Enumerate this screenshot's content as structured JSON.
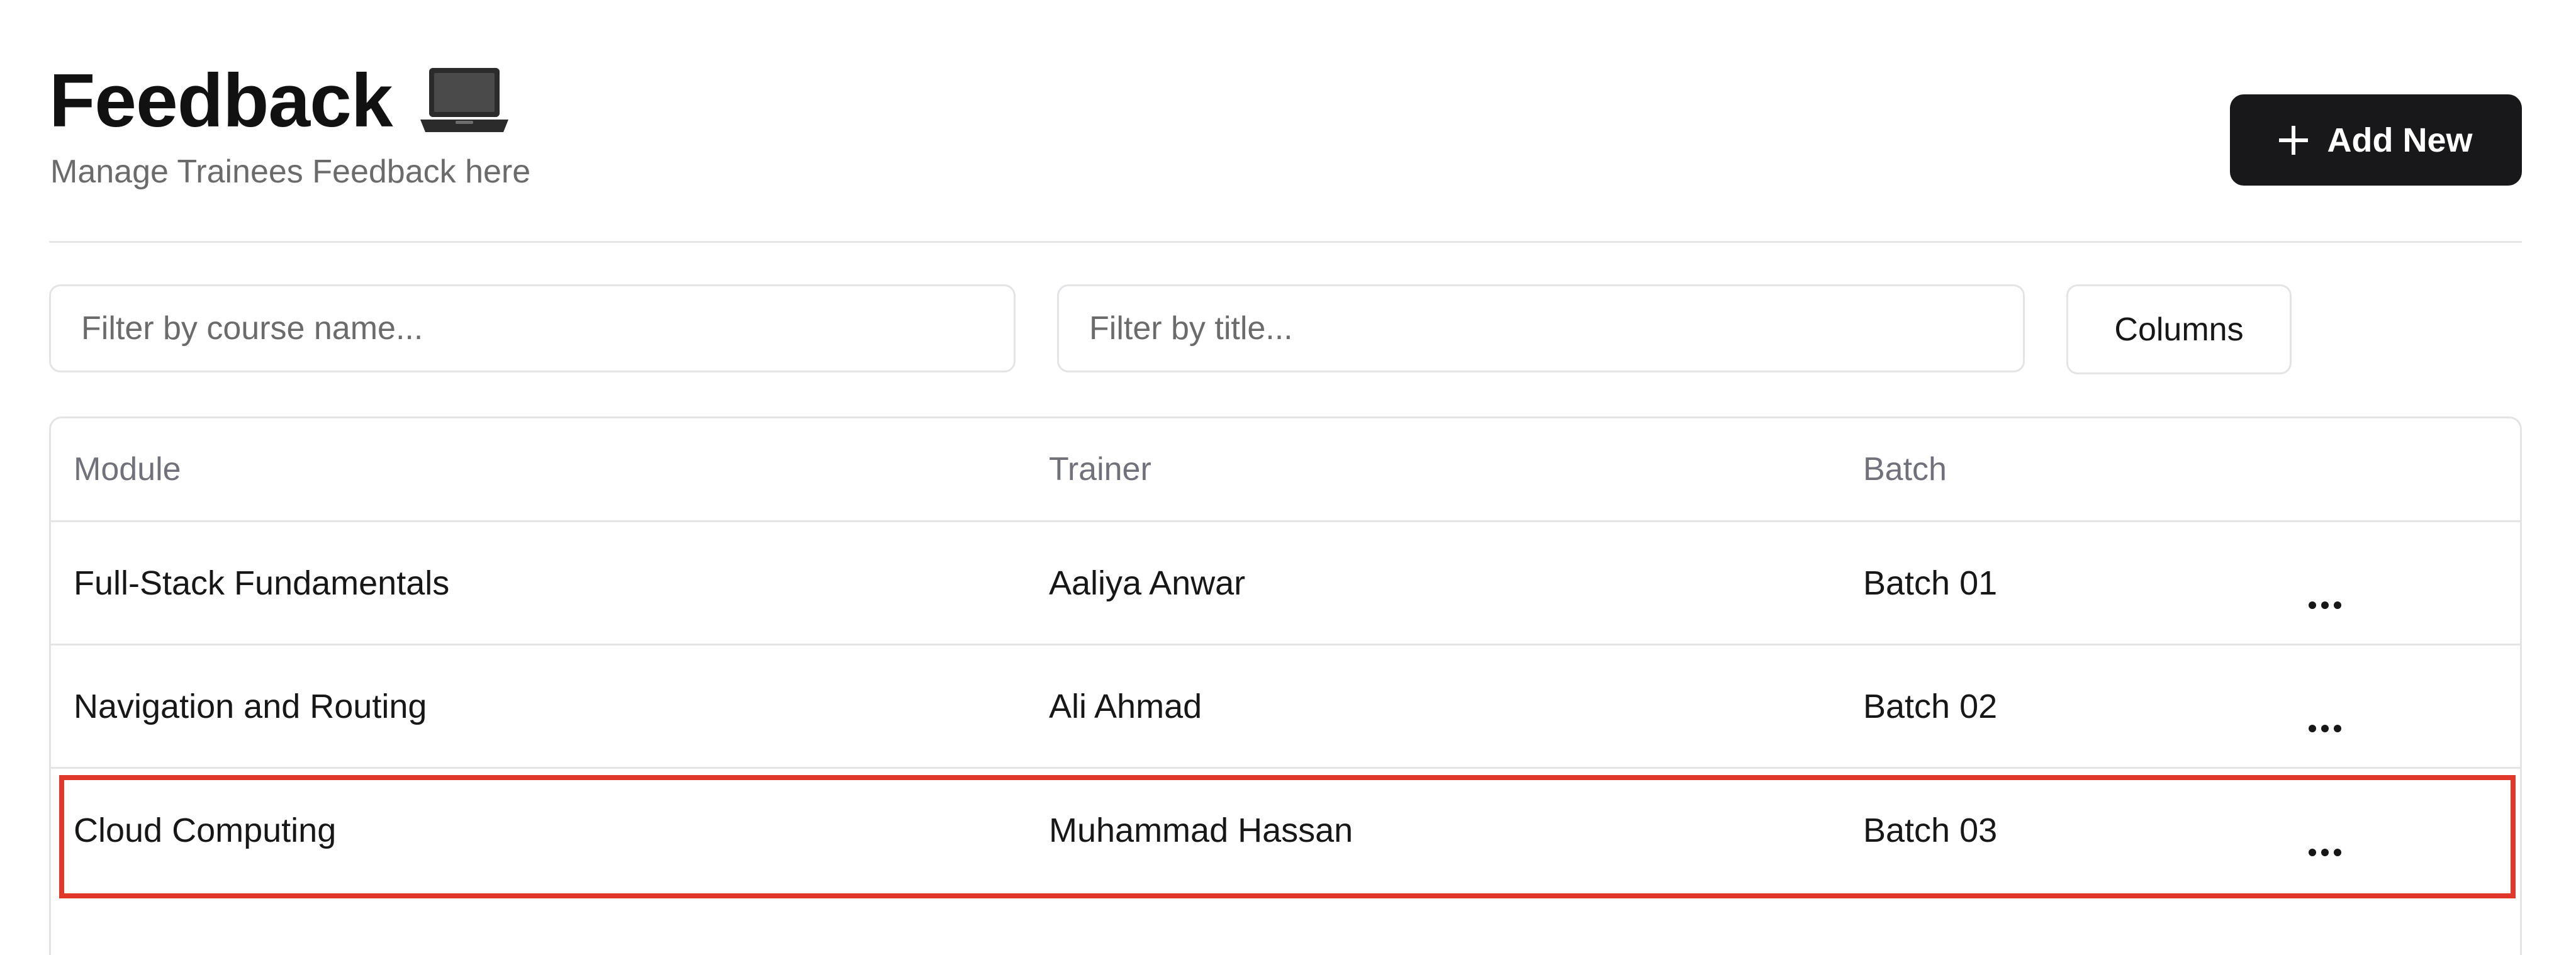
{
  "header": {
    "title": "Feedback",
    "subtitle": "Manage Trainees Feedback here",
    "title_icon": "laptop-icon",
    "add_button": {
      "label": "Add New",
      "icon": "plus-icon"
    }
  },
  "filters": {
    "course_placeholder": "Filter by course name...",
    "title_placeholder": "Filter by title...",
    "columns_label": "Columns"
  },
  "table": {
    "headers": {
      "module": "Module",
      "trainer": "Trainer",
      "batch": "Batch"
    },
    "rows": [
      {
        "module": "Full-Stack Fundamentals",
        "trainer": "Aaliya Anwar",
        "batch": "Batch 01",
        "actions_icon": "more-horizontal-icon"
      },
      {
        "module": "Navigation and Routing",
        "trainer": "Ali Ahmad",
        "batch": "Batch 02",
        "actions_icon": "more-horizontal-icon"
      },
      {
        "module": "Cloud Computing",
        "trainer": "Muhammad Hassan",
        "batch": "Batch 03",
        "actions_icon": "more-horizontal-icon"
      }
    ],
    "highlighted_row": 3
  },
  "colors": {
    "primary_button": "#18181b",
    "border": "#e4e4e7",
    "muted_text": "#6b6b6b",
    "highlight": "#e0392b"
  }
}
